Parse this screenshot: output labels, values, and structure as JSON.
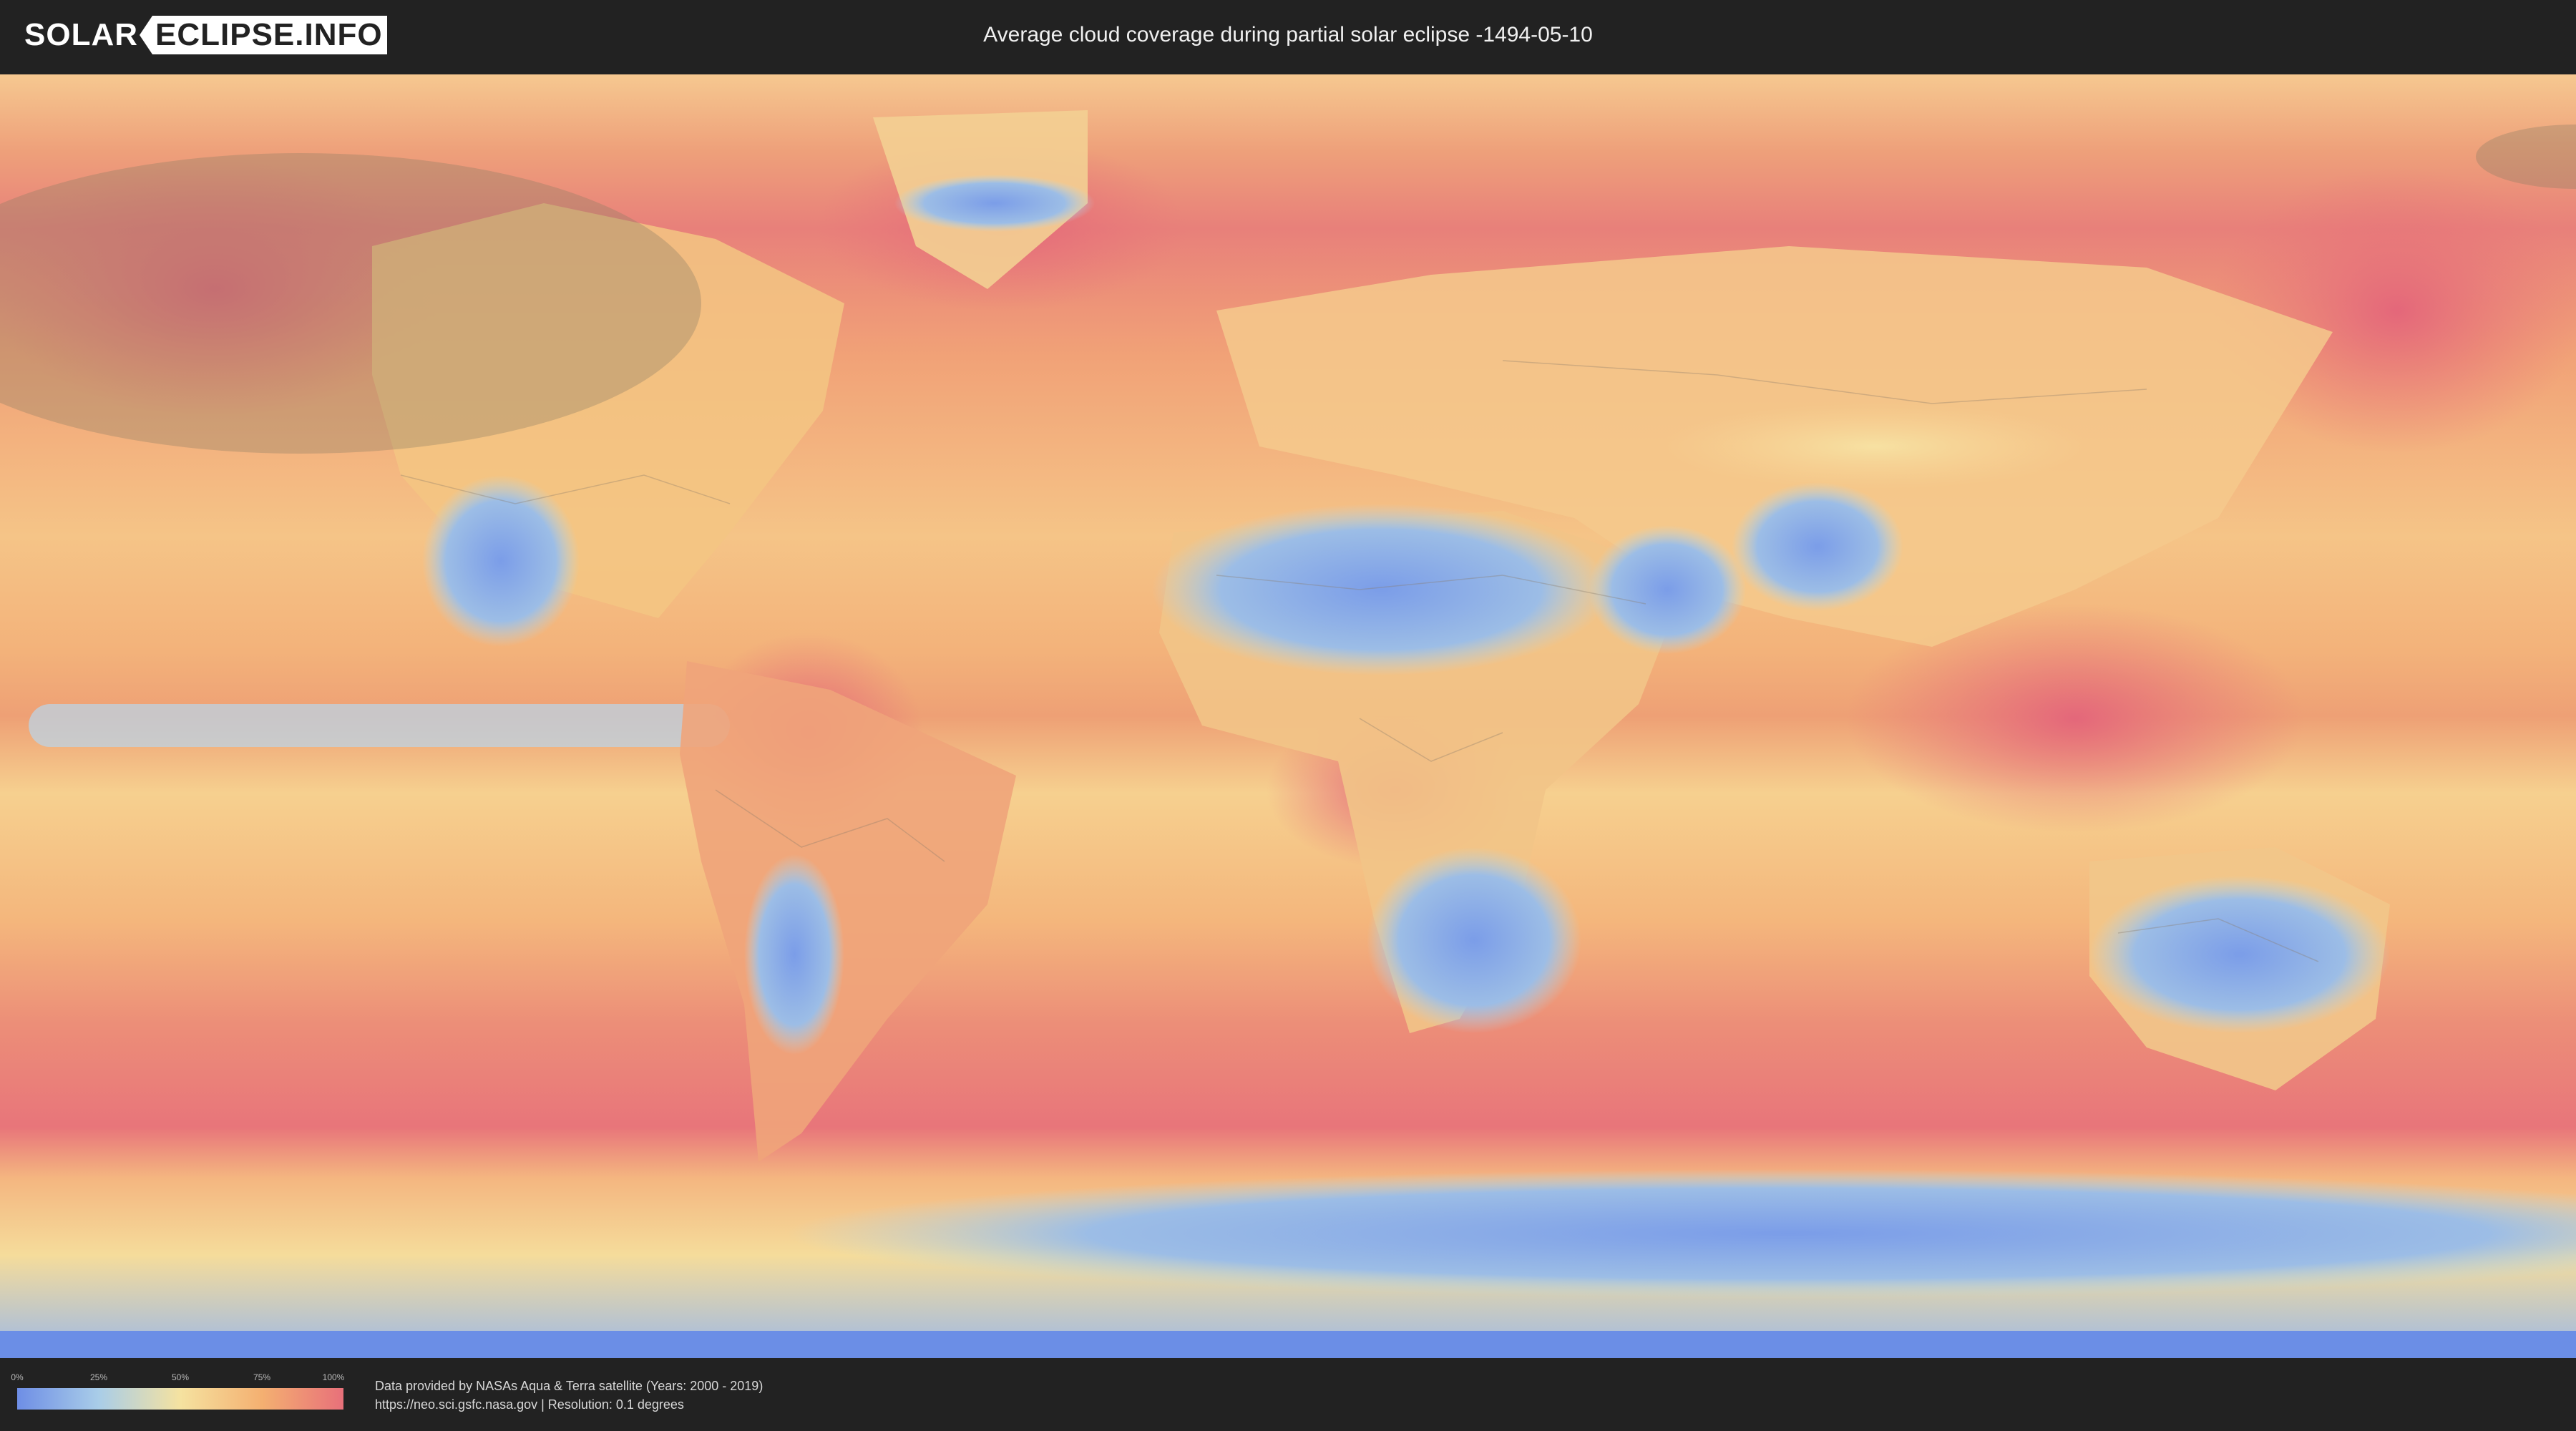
{
  "header": {
    "logo_solar": "SOLAR",
    "logo_eclipse": "ECLIPSE.INFO",
    "title": "Average cloud coverage during partial solar eclipse -1494-05-10"
  },
  "map": {
    "description_layer": "cloud-coverage",
    "colors": {
      "clear": "#6e8ee6",
      "low": "#a9cde8",
      "mid": "#f5e2a0",
      "high": "#f4b071",
      "overcast": "#e8707a",
      "eclipse_shadow": "#8b7e63"
    }
  },
  "legend": {
    "ticks": [
      "0%",
      "25%",
      "50%",
      "75%",
      "100%"
    ]
  },
  "credits": {
    "line1": "Data provided by NASAs Aqua & Terra satellite (Years: 2000 - 2019)",
    "line2": "https://neo.sci.gsfc.nasa.gov | Resolution: 0.1 degrees"
  }
}
